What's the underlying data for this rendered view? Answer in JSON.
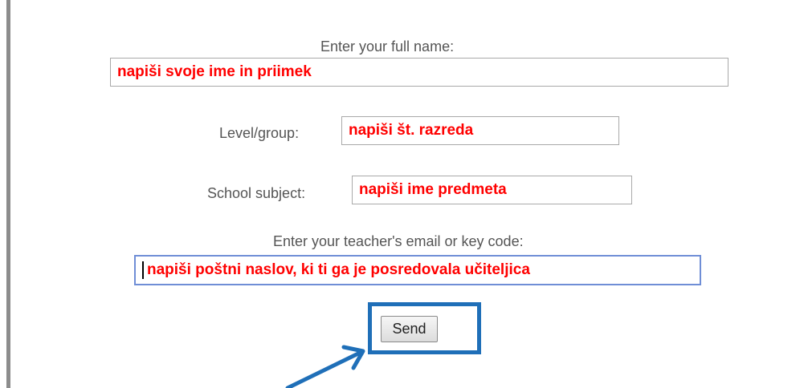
{
  "form": {
    "name_label": "Enter your full name:",
    "name_value": "napiši svoje ime in priimek",
    "level_label": "Level/group:",
    "level_value": "napiši št. razreda",
    "subject_label": "School subject:",
    "subject_value": "napiši ime predmeta",
    "email_label": "Enter your teacher's email or key code:",
    "email_value": "napiši poštni naslov, ki ti ga je posredovala učiteljica",
    "send_label": "Send"
  },
  "colors": {
    "field_text": "#ff0000",
    "highlight": "#1f6fb8",
    "focus_border": "#6f8ed6"
  }
}
